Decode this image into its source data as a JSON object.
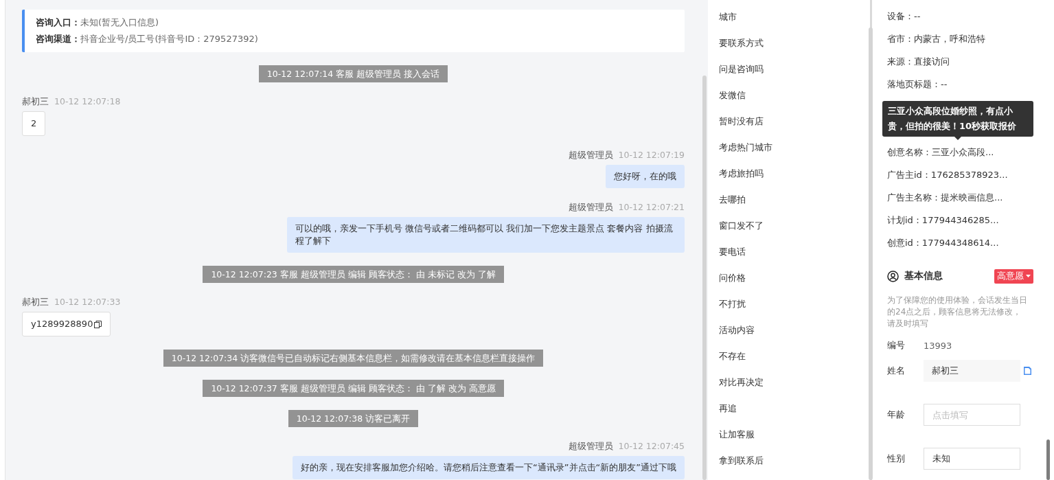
{
  "consult_info": [
    {
      "label": "咨询入口：",
      "value": "未知(暂无入口信息)"
    },
    {
      "label": "咨询渠道：",
      "value": "抖音企业号/员工号(抖音号ID：279527392)"
    }
  ],
  "messages": [
    {
      "kind": "system",
      "text": "10-12 12:07:14 客服 超级管理员 接入会话"
    },
    {
      "kind": "customer",
      "sender": "郝初三",
      "time": "10-12 12:07:18",
      "text": "2",
      "copyable": false
    },
    {
      "kind": "agent",
      "sender": "超级管理员",
      "time": "10-12 12:07:19",
      "text": "您好呀，在的哦",
      "copyable": false
    },
    {
      "kind": "agent",
      "sender": "超级管理员",
      "time": "10-12 12:07:21",
      "text": "可以的哦，亲发一下手机号 微信号或者二维码都可以 我们加一下您发主题景点 套餐内容 拍摄流程了解下",
      "copyable": false
    },
    {
      "kind": "system",
      "text": "10-12 12:07:23 客服 超级管理员 编辑 顾客状态： 由 未标记 改为 了解"
    },
    {
      "kind": "customer",
      "sender": "郝初三",
      "time": "10-12 12:07:33",
      "text": "y1289928890",
      "copyable": true
    },
    {
      "kind": "system",
      "text": "10-12 12:07:34 访客微信号已自动标记右侧基本信息栏，如需修改请在基本信息栏直接操作"
    },
    {
      "kind": "system",
      "text": "10-12 12:07:37 客服 超级管理员 编辑 顾客状态： 由 了解 改为 高意愿"
    },
    {
      "kind": "system",
      "text": "10-12 12:07:38 访客已离开"
    },
    {
      "kind": "agent",
      "sender": "超级管理员",
      "time": "10-12 12:07:45",
      "text": "好的亲，现在安排客服加您介绍哈。请您稍后注意查看一下“通讯录”并点击“新的朋友”通过下哦",
      "copyable": false
    }
  ],
  "quick_replies": [
    "城市",
    "要联系方式",
    "问是咨询吗",
    "发微信",
    "暂时没有店",
    "考虑热门城市",
    "考虑旅拍吗",
    "去哪拍",
    "窗口发不了",
    "要电话",
    "问价格",
    "不打扰",
    "活动内容",
    "不存在",
    "对比再决定",
    "再追",
    "让加客服",
    "拿到联系后"
  ],
  "visitor_info_top": [
    "设备：--",
    "省市：内蒙古，呼和浩特",
    "来源：直接访问",
    "落地页标题：--"
  ],
  "tooltip": "三亚小众高段位婚纱照，有点小贵，但拍的很美！10秒获取报价",
  "visitor_info_bottom": [
    "创意名称：三亚小众高段...",
    "广告主id：176285378923...",
    "广告主名称：提米映画信息...",
    "计划id：177944346285...",
    "创意id：177944348614..."
  ],
  "basic_info": {
    "title": "基本信息",
    "status": "高意愿",
    "notice": "为了保障您的使用体验，会话发生当日的24点之后，顾客信息将无法修改，请及时填写",
    "fields": [
      {
        "kind": "static",
        "label": "编号",
        "value": "13993"
      },
      {
        "kind": "filled",
        "label": "姓名",
        "value": "郝初三"
      },
      {
        "kind": "input",
        "label": "年龄",
        "placeholder": "点击填写"
      },
      {
        "kind": "input",
        "label": "性别",
        "value": "未知"
      }
    ]
  }
}
